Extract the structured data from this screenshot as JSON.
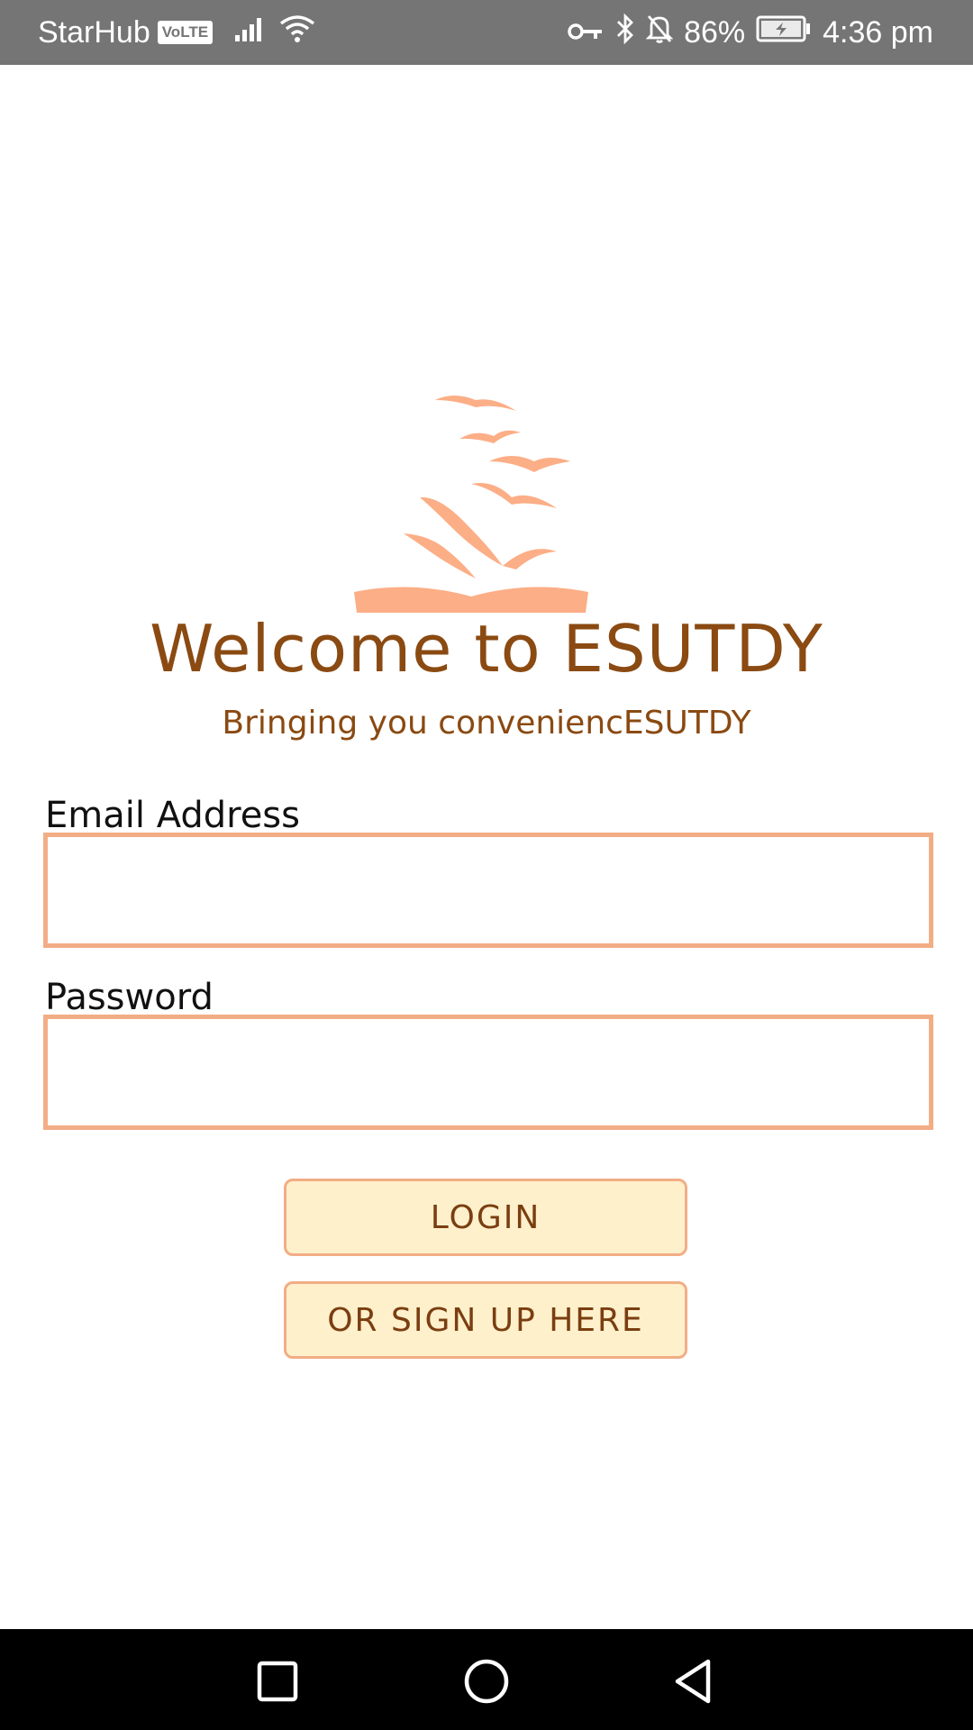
{
  "status_bar": {
    "carrier": "StarHub",
    "volte": "VoLTE",
    "battery": "86%",
    "time": "4:36 pm",
    "icons": [
      "signal-icon",
      "wifi-icon",
      "key-icon",
      "bluetooth-icon",
      "notifications-off-icon",
      "battery-charging-icon"
    ]
  },
  "header": {
    "title": "Welcome to ESUTDY",
    "subtitle": "Bringing you conveniencESUTDY",
    "logo_icon": "book-birds-logo"
  },
  "form": {
    "email_label": "Email Address",
    "email_value": "",
    "password_label": "Password",
    "password_value": ""
  },
  "actions": {
    "login_label": "LOGIN",
    "signup_label": "OR SIGN UP HERE"
  },
  "nav_bar": {
    "icons": [
      "recent-apps-icon",
      "home-icon",
      "back-icon"
    ]
  },
  "colors": {
    "accent": "#f2ad85",
    "brand_text": "#8a4a12",
    "button_bg": "#fff0cc",
    "status_bar": "#757575"
  }
}
